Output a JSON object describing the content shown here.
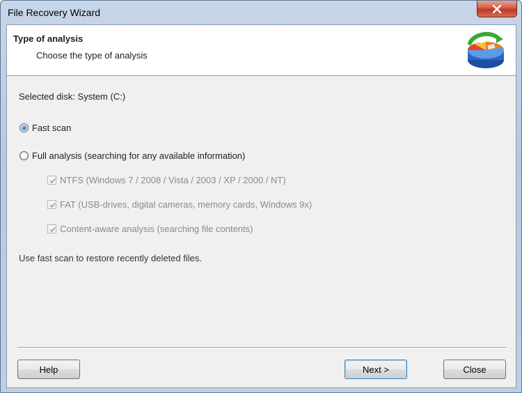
{
  "window": {
    "title": "File Recovery Wizard"
  },
  "header": {
    "title": "Type of analysis",
    "subtitle": "Choose the type of analysis"
  },
  "main": {
    "selected_disk": "Selected disk: System (C:)",
    "options": {
      "fast_scan": {
        "label": "Fast scan",
        "checked": true
      },
      "full_analysis": {
        "label": "Full analysis (searching for any available information)",
        "checked": false
      }
    },
    "sub_options": [
      {
        "label": "NTFS (Windows 7 / 2008 / Vista / 2003 / XP / 2000 / NT)",
        "checked": true,
        "disabled": true
      },
      {
        "label": "FAT (USB-drives, digital cameras, memory cards, Windows 9x)",
        "checked": true,
        "disabled": true
      },
      {
        "label": "Content-aware analysis (searching file contents)",
        "checked": true,
        "disabled": true
      }
    ],
    "hint": "Use fast scan to restore recently deleted files."
  },
  "footer": {
    "help_label": "Help",
    "next_label": "Next >",
    "close_label": "Close"
  },
  "icons": {
    "close": "close-icon",
    "logo": "disk-recovery-logo-icon"
  }
}
